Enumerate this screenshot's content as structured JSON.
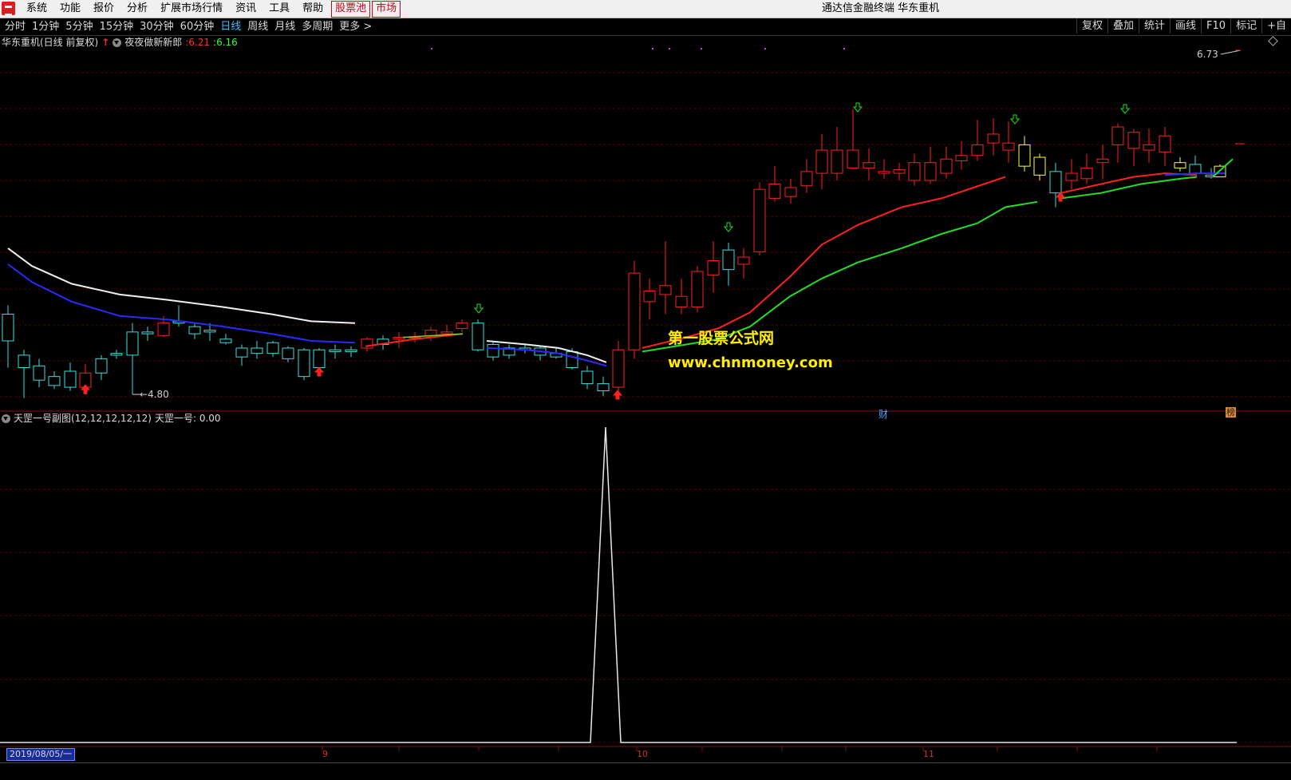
{
  "window": {
    "title": "通达信金融终端 华东重机"
  },
  "menu": [
    {
      "label": "系统"
    },
    {
      "label": "功能"
    },
    {
      "label": "报价"
    },
    {
      "label": "分析"
    },
    {
      "label": "扩展市场行情"
    },
    {
      "label": "资讯"
    },
    {
      "label": "工具"
    },
    {
      "label": "帮助"
    },
    {
      "label": "股票池",
      "boxed": true
    },
    {
      "label": "市场",
      "boxed": true
    }
  ],
  "periods": [
    {
      "label": "分时"
    },
    {
      "label": "1分钟"
    },
    {
      "label": "5分钟"
    },
    {
      "label": "15分钟"
    },
    {
      "label": "30分钟"
    },
    {
      "label": "60分钟"
    },
    {
      "label": "日线",
      "active": true
    },
    {
      "label": "周线"
    },
    {
      "label": "月线"
    },
    {
      "label": "多周期"
    },
    {
      "label": "更多 >"
    }
  ],
  "tools": [
    {
      "label": "复权"
    },
    {
      "label": "叠加"
    },
    {
      "label": "统计"
    },
    {
      "label": "画线"
    },
    {
      "label": "F10"
    },
    {
      "label": "标记"
    },
    {
      "label": "+自"
    }
  ],
  "main_chart": {
    "stock_title": "华东重机(日线 前复权)",
    "indicator_name": "夜夜做新新郎",
    "value_red": ":6.21",
    "value_green": ":6.16",
    "high_label": "6.73",
    "low_label": "4.80",
    "colors": {
      "up": "#ff2020",
      "down": "#38e0e0",
      "ma_short": "#ff2020",
      "ma_long": "#22dd22",
      "ma_white": "#f0f0f0",
      "ma_blue": "#2a2aff",
      "grid": "#5a0000"
    }
  },
  "watermark": {
    "line1": "第一股票公式网",
    "line2": "www.chnmoney.com"
  },
  "badges": {
    "cai": "财",
    "bang": "榜"
  },
  "sub_chart": {
    "indicator_title": "天罡一号副图(12,12,12,12,12)",
    "value_label": "天罡一号: 0.00"
  },
  "x_axis": {
    "date": "2019/08/05/一",
    "months": [
      "9",
      "10",
      "11"
    ]
  }
}
